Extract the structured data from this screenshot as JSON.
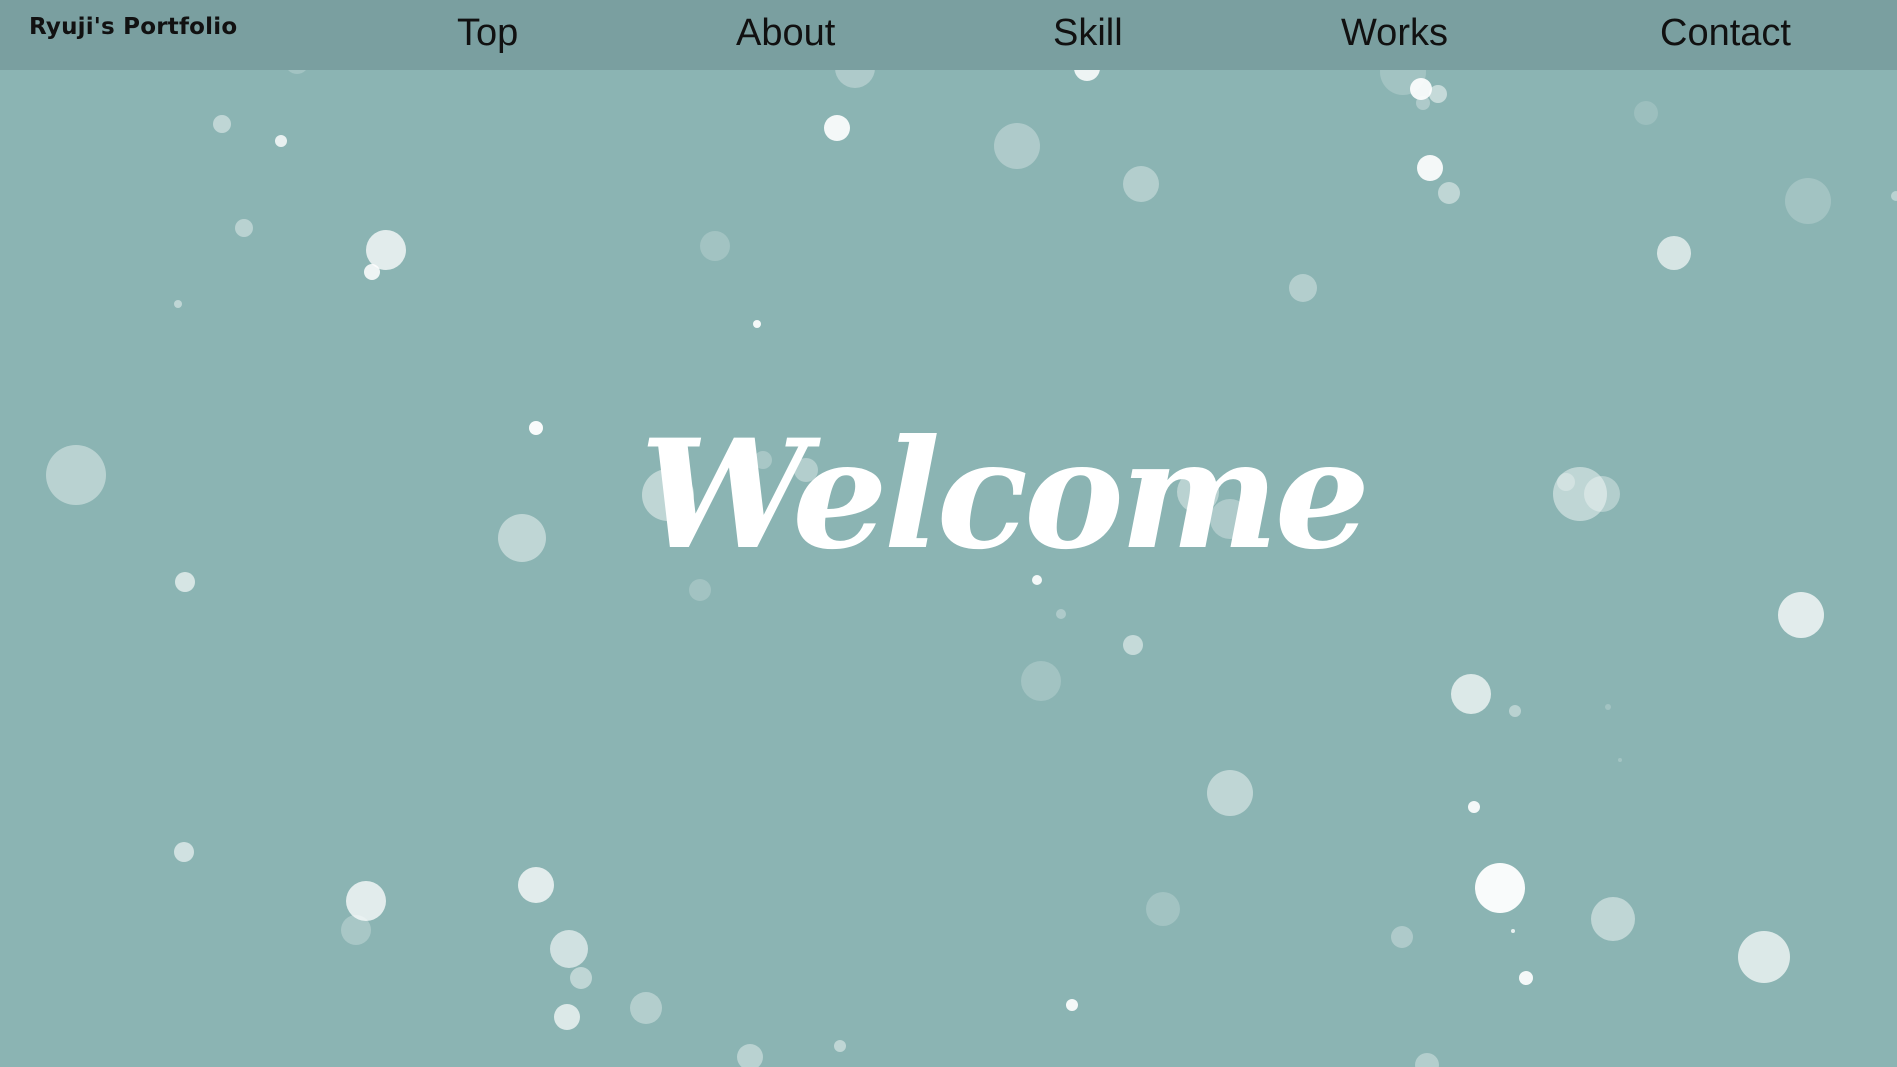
{
  "header": {
    "logo": "Ryuji's Portfolio",
    "nav": {
      "top": "Top",
      "about": "About",
      "skill": "Skill",
      "works": "Works",
      "contact": "Contact"
    }
  },
  "hero": {
    "title": "Welcome"
  },
  "colors": {
    "background": "#8bb4b3",
    "header": "#7a9fa0",
    "text": "#111111",
    "bubble": "#ffffff"
  }
}
